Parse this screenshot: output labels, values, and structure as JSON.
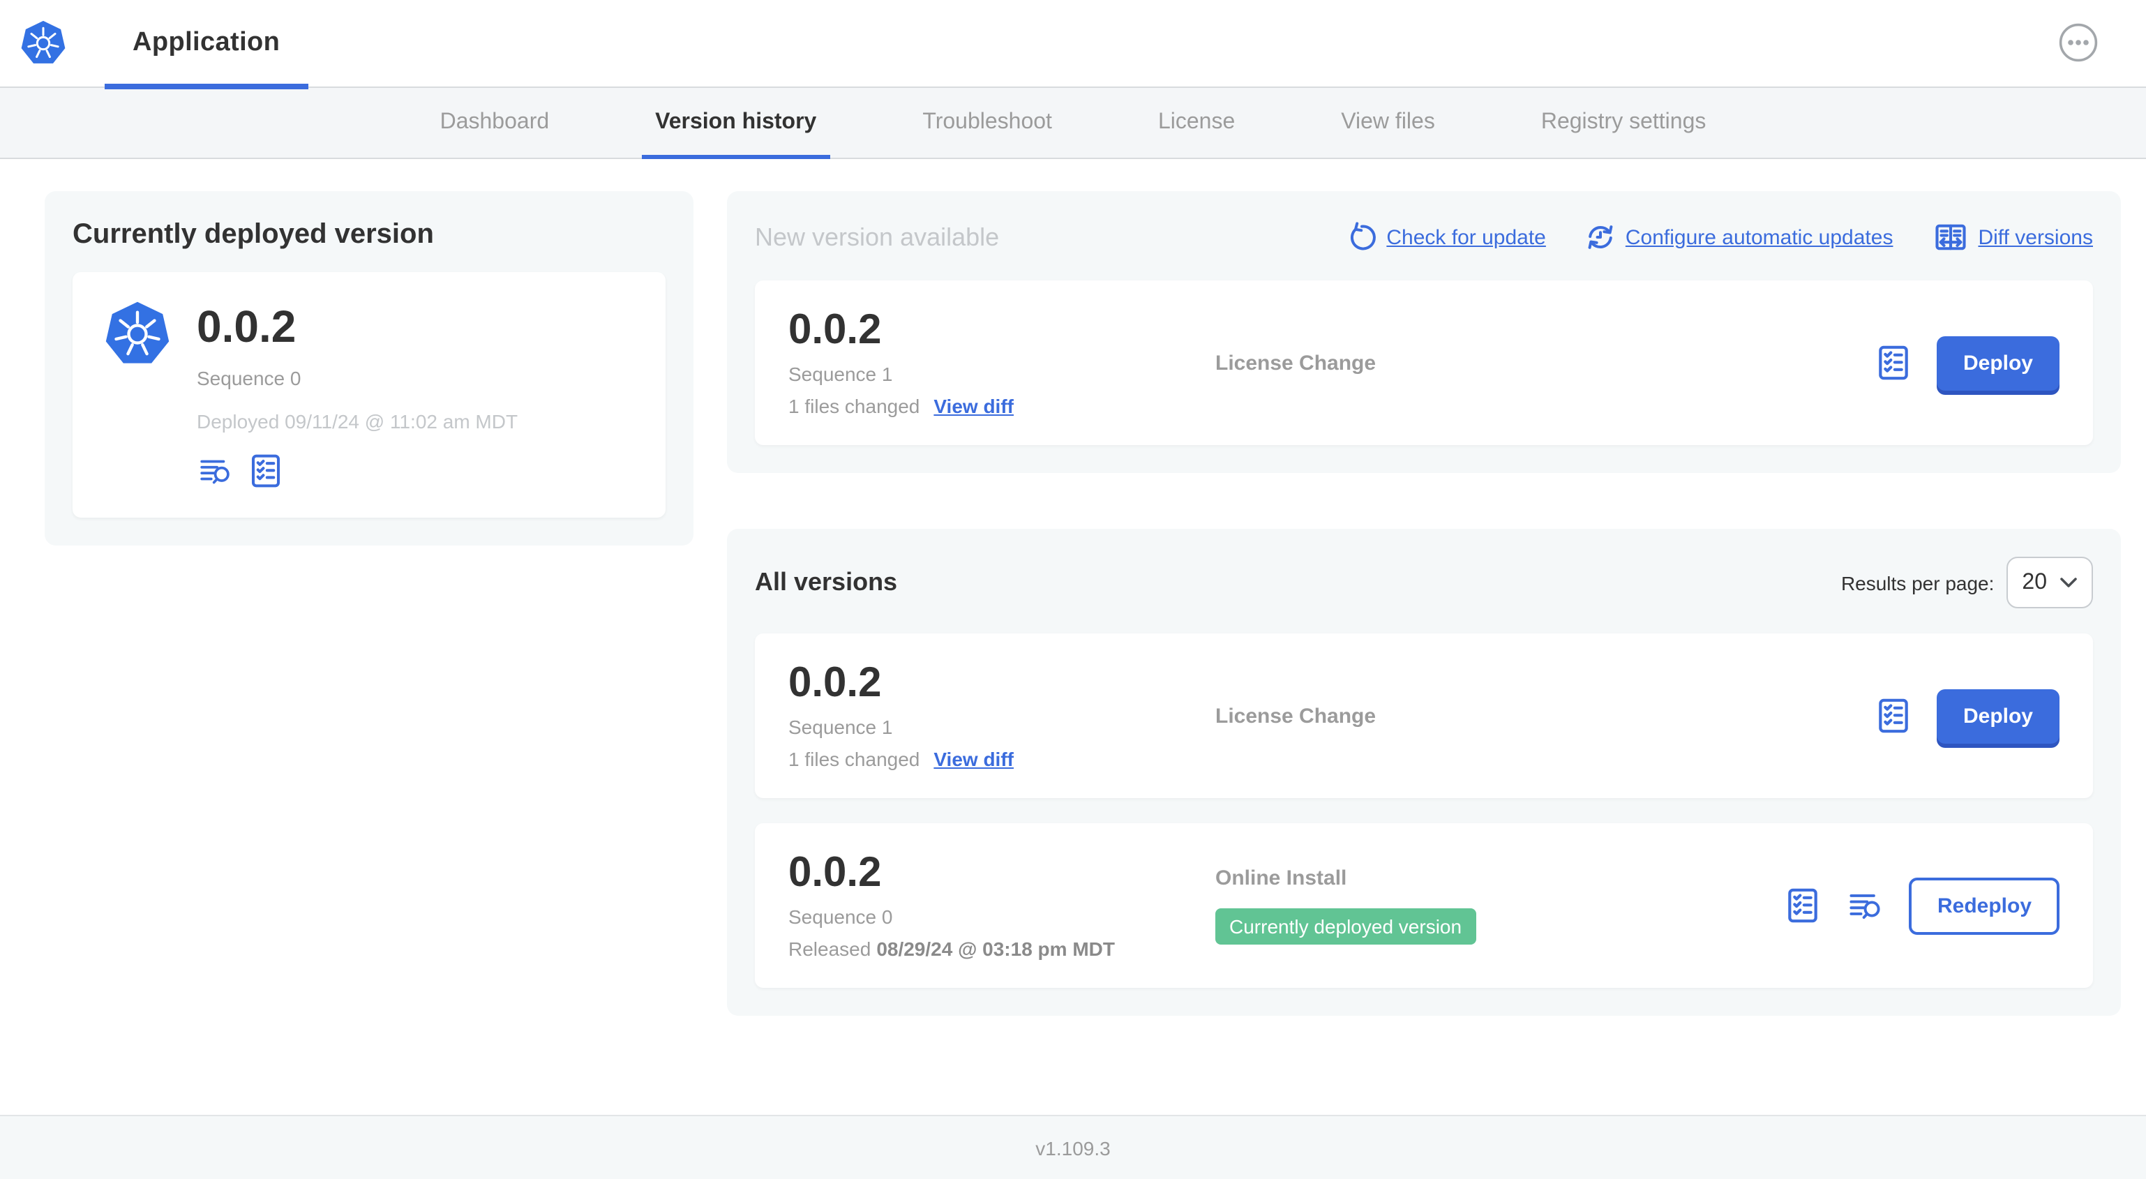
{
  "header": {
    "app_title": "Application"
  },
  "nav": {
    "tabs": [
      {
        "label": "Dashboard",
        "active": false
      },
      {
        "label": "Version history",
        "active": true
      },
      {
        "label": "Troubleshoot",
        "active": false
      },
      {
        "label": "License",
        "active": false
      },
      {
        "label": "View files",
        "active": false
      },
      {
        "label": "Registry settings",
        "active": false
      }
    ]
  },
  "current_version": {
    "title": "Currently deployed version",
    "version": "0.0.2",
    "sequence": "Sequence 0",
    "deployed": "Deployed 09/11/24 @ 11:02 am MDT"
  },
  "new_version": {
    "title": "New version available",
    "actions": {
      "check": "Check for update",
      "configure": "Configure automatic updates",
      "diff": "Diff versions"
    },
    "row": {
      "version": "0.0.2",
      "sequence": "Sequence 1",
      "files_changed": "1 files changed",
      "view_diff": "View diff",
      "source": "License Change",
      "deploy": "Deploy"
    }
  },
  "all_versions": {
    "title": "All versions",
    "results_per_page_label": "Results per page:",
    "results_per_page": "20",
    "rows": [
      {
        "version": "0.0.2",
        "sequence": "Sequence 1",
        "files_changed": "1 files changed",
        "view_diff": "View diff",
        "source": "License Change",
        "action": "Deploy"
      },
      {
        "version": "0.0.2",
        "sequence": "Sequence 0",
        "released_prefix": "Released",
        "released_date": "08/29/24 @ 03:18 pm MDT",
        "source": "Online Install",
        "badge": "Currently deployed version",
        "action": "Redeploy"
      }
    ]
  },
  "footer": {
    "app_version": "v1.109.3"
  },
  "colors": {
    "primary_blue": "#3b6cdd",
    "badge_green": "#61c494",
    "logo_blue": "#3371e3",
    "card_gray": "#f5f8f9"
  }
}
